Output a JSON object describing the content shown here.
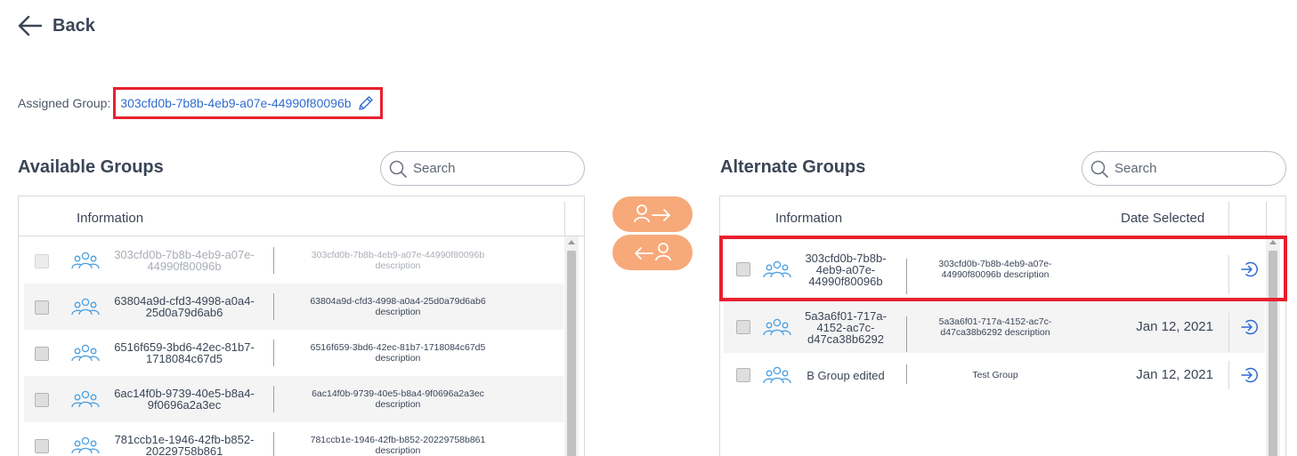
{
  "nav": {
    "back_label": "Back",
    "back_icon": "arrow-left-icon"
  },
  "assigned": {
    "label": "Assigned Group:",
    "group_id": "303cfd0b-7b8b-4eb9-a07e-44990f80096b",
    "edit_icon": "pencil-icon"
  },
  "available": {
    "title": "Available Groups",
    "search_placeholder": "Search",
    "header_information": "Information",
    "rows": [
      {
        "name": "303cfd0b-7b8b-4eb9-a07e-44990f80096b",
        "description": "303cfd0b-7b8b-4eb9-a07e-44990f80096b description",
        "disabled": true
      },
      {
        "name": "63804a9d-cfd3-4998-a0a4-25d0a79d6ab6",
        "description": "63804a9d-cfd3-4998-a0a4-25d0a79d6ab6 description",
        "disabled": false
      },
      {
        "name": "6516f659-3bd6-42ec-81b7-1718084c67d5",
        "description": "6516f659-3bd6-42ec-81b7-1718084c67d5 description",
        "disabled": false
      },
      {
        "name": "6ac14f0b-9739-40e5-b8a4-9f0696a2a3ec",
        "description": "6ac14f0b-9739-40e5-b8a4-9f0696a2a3ec description",
        "disabled": false
      },
      {
        "name": "781ccb1e-1946-42fb-b852-20229758b861",
        "description": "781ccb1e-1946-42fb-b852-20229758b861 description",
        "disabled": false
      }
    ]
  },
  "transfer": {
    "move_right_icon": "user-arrow-right-icon",
    "move_left_icon": "user-arrow-left-icon",
    "color": "#f7a97a"
  },
  "alternate": {
    "title": "Alternate Groups",
    "search_placeholder": "Search",
    "header_information": "Information",
    "header_date": "Date Selected",
    "rows": [
      {
        "name": "303cfd0b-7b8b-4eb9-a07e-44990f80096b",
        "description": "303cfd0b-7b8b-4eb9-a07e-44990f80096b description",
        "date": ""
      },
      {
        "name": "5a3a6f01-717a-4152-ac7c-d47ca38b6292",
        "description": "5a3a6f01-717a-4152-ac7c-d47ca38b6292 description",
        "date": "Jan 12, 2021"
      },
      {
        "name": "B Group edited",
        "description": "Test Group",
        "date": "Jan 12, 2021"
      }
    ]
  },
  "colors": {
    "accent": "#2f6ccf",
    "highlight": "#e8202e",
    "icon": "#4a9fe0"
  }
}
